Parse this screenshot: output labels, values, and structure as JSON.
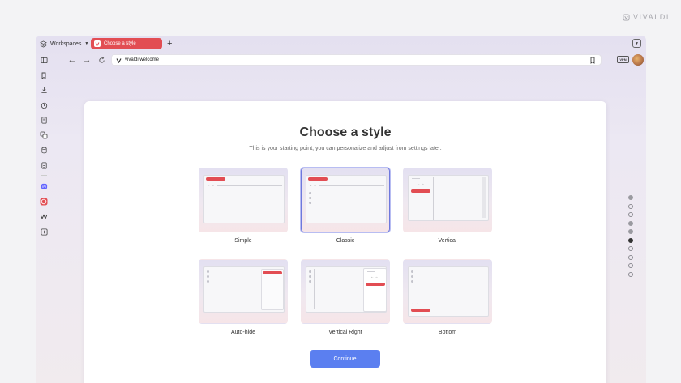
{
  "brand": {
    "logo_text": "VIVALDI"
  },
  "tabbar": {
    "workspaces_label": "Workspaces",
    "active_tab_title": "Choose a style",
    "new_tab_symbol": "+"
  },
  "addressbar": {
    "back": "←",
    "forward": "→",
    "url": "vivaldi:welcome",
    "vpn_label": "VPN"
  },
  "page": {
    "title": "Choose a style",
    "subtitle": "This is your starting point, you can personalize and adjust from settings later.",
    "options": [
      {
        "label": "Simple",
        "selected": false
      },
      {
        "label": "Classic",
        "selected": true
      },
      {
        "label": "Vertical",
        "selected": false
      },
      {
        "label": "Auto-hide",
        "selected": false
      },
      {
        "label": "Vertical Right",
        "selected": false
      },
      {
        "label": "Bottom",
        "selected": false
      }
    ],
    "continue_label": "Continue"
  },
  "pagination": {
    "total": 10,
    "current": 6
  },
  "side_panel": [
    "panel-toggle-icon",
    "bookmarks-icon",
    "downloads-icon",
    "history-icon",
    "notes-icon",
    "translate-icon",
    "reading-list-icon",
    "window-icon",
    "mastodon-icon",
    "vivaldi-icon",
    "wikipedia-icon",
    "add-panel-icon"
  ],
  "colors": {
    "accent": "#e24d53",
    "button": "#5b7ff0",
    "selected_border": "#6e78dd"
  }
}
